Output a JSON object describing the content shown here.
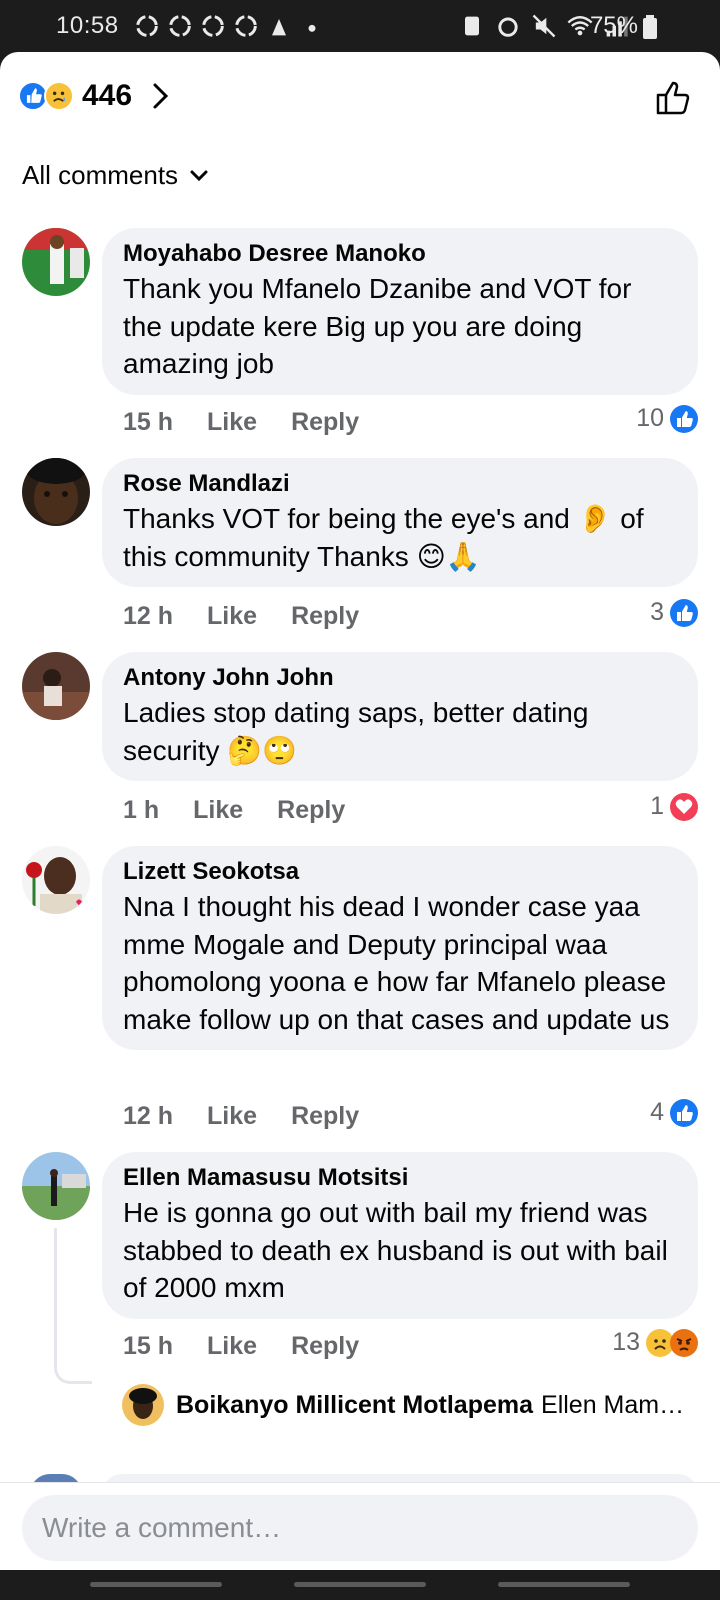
{
  "status_bar": {
    "time": "10:58",
    "battery": "75%"
  },
  "header": {
    "reaction_count": "446",
    "reaction_icons": [
      "like-icon",
      "sad-icon"
    ]
  },
  "filter": {
    "label": "All comments"
  },
  "comments": [
    {
      "author": "Moyahabo Desree Manoko",
      "text": "Thank you Mfanelo Dzanibe and VOT for the update kere Big up you are doing amazing job",
      "time": "15 h",
      "like_label": "Like",
      "reply_label": "Reply",
      "reaction_count": "10",
      "reactions": [
        "like"
      ]
    },
    {
      "author": "Rose Mandlazi",
      "text": "Thanks VOT for being the eye's and 👂 of this community Thanks 😊🙏",
      "time": "12 h",
      "like_label": "Like",
      "reply_label": "Reply",
      "reaction_count": "3",
      "reactions": [
        "like"
      ]
    },
    {
      "author": "Antony John John",
      "text": "Ladies stop dating saps, better dating security 🤔🙄",
      "time": "1 h",
      "like_label": "Like",
      "reply_label": "Reply",
      "reaction_count": "1",
      "reactions": [
        "love"
      ]
    },
    {
      "author": "Lizett Seokotsa",
      "text": "Nna I thought his dead I wonder case yaa mme Mogale and Deputy principal waa phomolong yoona e how far Mfanelo please make follow up on that cases and update us",
      "time": "12 h",
      "like_label": "Like",
      "reply_label": "Reply",
      "reaction_count": "4",
      "reactions": [
        "like"
      ]
    },
    {
      "author": "Ellen Mamasusu Motsitsi",
      "text": "He is gonna go out with bail my friend was stabbed to death ex husband is out with bail of 2000 mxm",
      "time": "15 h",
      "like_label": "Like",
      "reply_label": "Reply",
      "reaction_count": "13",
      "reactions": [
        "sad",
        "angry"
      ],
      "reply_preview": {
        "author": "Boikanyo Millicent Motlapema",
        "text": "Ellen Mam…"
      }
    }
  ],
  "composer": {
    "placeholder": "Write a comment…"
  },
  "colors": {
    "accent": "#1877f2",
    "bubble": "#f0f2f5",
    "meta": "#65676b",
    "love": "#f33e58"
  }
}
